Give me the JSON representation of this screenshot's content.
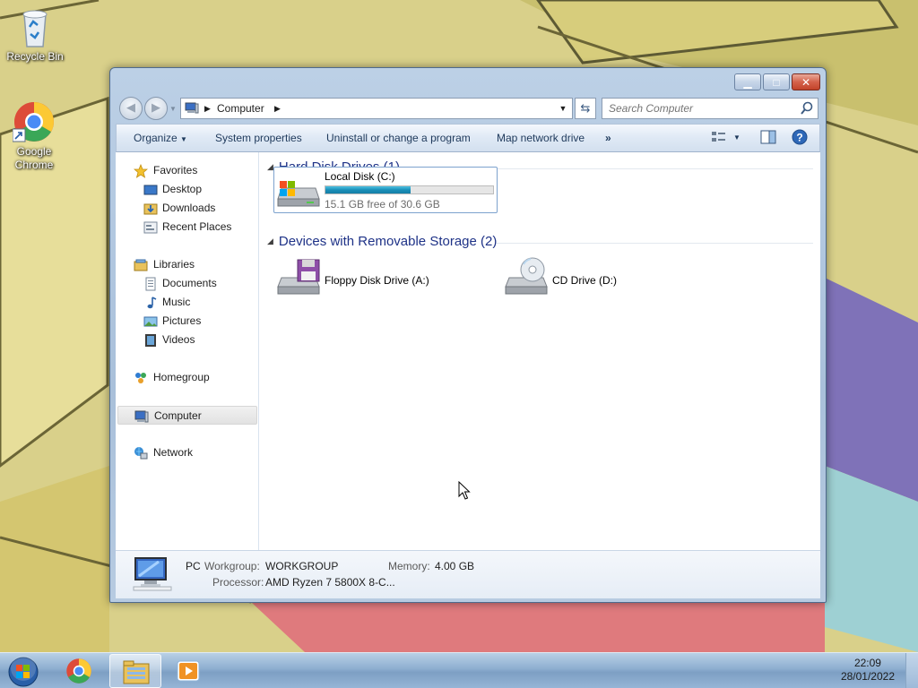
{
  "desktop": {
    "icons": [
      {
        "label": "Recycle Bin",
        "icon": "recycle-bin-icon"
      },
      {
        "label": "Google Chrome",
        "icon": "chrome-icon"
      }
    ]
  },
  "window": {
    "address": {
      "location": "Computer"
    },
    "search": {
      "placeholder": "Search Computer"
    },
    "toolbar": {
      "organize": "Organize",
      "system_properties": "System properties",
      "uninstall": "Uninstall or change a program",
      "map_network": "Map network drive",
      "more": "»"
    },
    "nav": {
      "favorites": "Favorites",
      "desktop": "Desktop",
      "downloads": "Downloads",
      "recent_places": "Recent Places",
      "libraries": "Libraries",
      "documents": "Documents",
      "music": "Music",
      "pictures": "Pictures",
      "videos": "Videos",
      "homegroup": "Homegroup",
      "computer": "Computer",
      "network": "Network"
    },
    "groups": {
      "hard_disks": {
        "title": "Hard Disk Drives (1)",
        "drives": [
          {
            "name": "Local Disk (C:)",
            "free_text": "15.1 GB free of 30.6 GB",
            "used_fraction": 0.51
          }
        ]
      },
      "removable": {
        "title": "Devices with Removable Storage (2)",
        "drives": [
          {
            "name": "Floppy Disk Drive (A:)"
          },
          {
            "name": "CD Drive (D:)"
          }
        ]
      }
    },
    "details": {
      "name": "PC",
      "workgroup_label": "Workgroup:",
      "workgroup_value": "WORKGROUP",
      "memory_label": "Memory:",
      "memory_value": "4.00 GB",
      "processor_label": "Processor:",
      "processor_value": "AMD Ryzen 7 5800X 8-C..."
    }
  },
  "taskbar": {
    "time": "22:09",
    "date": "28/01/2022"
  },
  "colors": {
    "group_header": "#1e3287",
    "usage_bar": "#1a8fb8",
    "window_frame": "#a9c0da"
  }
}
